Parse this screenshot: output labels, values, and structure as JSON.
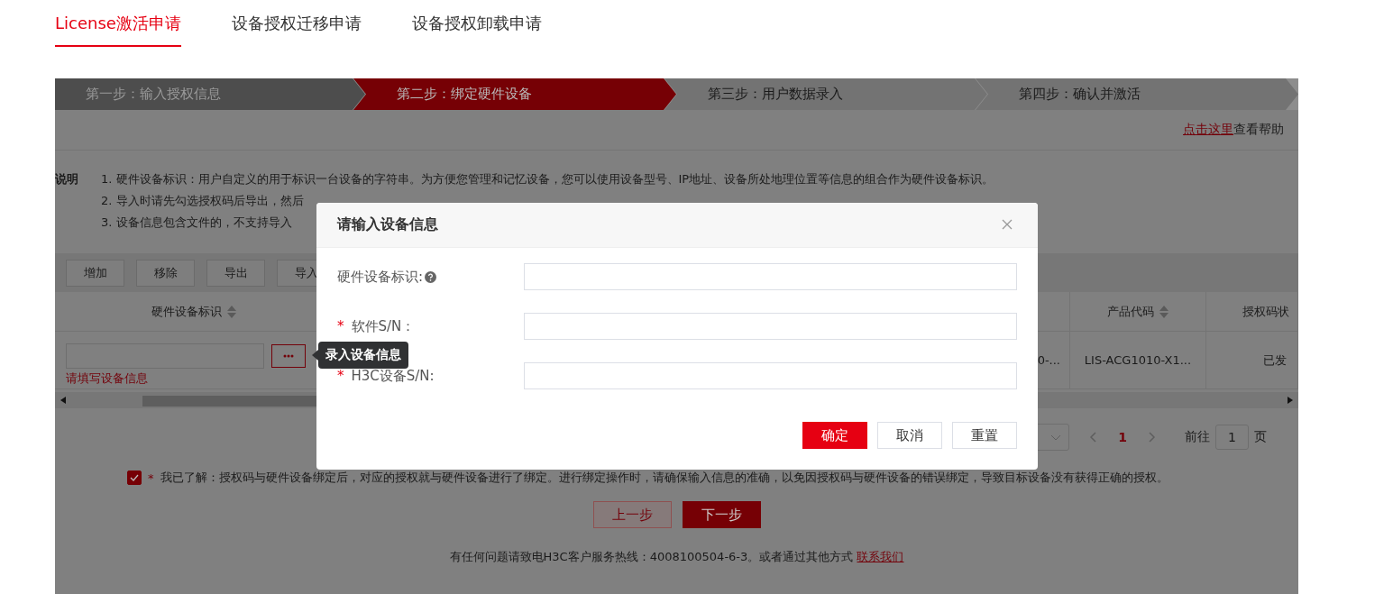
{
  "tabs": [
    {
      "label": "License激活申请",
      "selected": true
    },
    {
      "label": "设备授权迁移申请",
      "selected": false
    },
    {
      "label": "设备授权卸载申请",
      "selected": false
    }
  ],
  "steps": [
    {
      "label": "第一步：输入授权信息",
      "completed": true,
      "selected": false
    },
    {
      "label": "第二步：绑定硬件设备",
      "completed": false,
      "selected": true
    },
    {
      "label": "第三步：用户数据录入",
      "completed": false,
      "selected": false
    },
    {
      "label": "第四步：确认并激活",
      "completed": false,
      "selected": false
    }
  ],
  "help": {
    "link": "点击这里",
    "text": "查看帮助"
  },
  "notes": {
    "title": "说明",
    "items": [
      "1. 硬件设备标识：用户自定义的用于标识一台设备的字符串。为方便您管理和记忆设备，您可以使用设备型号、IP地址、设备所处地理位置等信息的组合作为硬件设备标识。",
      "2. 导入时请先勾选授权码后导出，然后",
      "3. 设备信息包含文件的，不支持导入"
    ]
  },
  "toolbar": [
    "增加",
    "移除",
    "导出",
    "导入"
  ],
  "table": {
    "columns": [
      {
        "label": "硬件设备标识",
        "sortable": true
      },
      {
        "label": "产品代码",
        "sortable": true
      },
      {
        "label": "授权码状"
      }
    ],
    "rows": [
      {
        "error": "请填写设备信息",
        "cells": [
          "0-...",
          "LIS-ACG1010-X1...",
          "已发"
        ]
      }
    ]
  },
  "pagination": {
    "page": "1",
    "goto_label": "前往",
    "goto_value": "1",
    "suffix": "页"
  },
  "agreement": {
    "checked": true,
    "mark": "*",
    "text": "我已了解：授权码与硬件设备绑定后，对应的授权就与硬件设备进行了绑定。进行绑定操作时，请确保输入信息的准确，以免因授权码与硬件设备的错误绑定，导致目标设备没有获得正确的授权。"
  },
  "nav_buttons": [
    {
      "label": "上一步",
      "kind": "secondary"
    },
    {
      "label": "下一步",
      "kind": "primary"
    }
  ],
  "footer": {
    "text": "有任何问题请致电H3C客户服务热线：4008100504-6-3。或者通过其他方式",
    "link": "联系我们"
  },
  "tooltip": {
    "text": "录入设备信息"
  },
  "modal": {
    "title": "请输入设备信息",
    "required_mark": "*",
    "fields": [
      {
        "label": "硬件设备标识:",
        "required": false,
        "help": true
      },
      {
        "label": "软件S/N：",
        "required": true,
        "help": false
      },
      {
        "label": "H3C设备S/N:",
        "required": true,
        "help": false
      }
    ],
    "buttons": [
      {
        "label": "确定",
        "kind": "primary"
      },
      {
        "label": "取消",
        "kind": "default"
      },
      {
        "label": "重置",
        "kind": "default"
      }
    ]
  }
}
